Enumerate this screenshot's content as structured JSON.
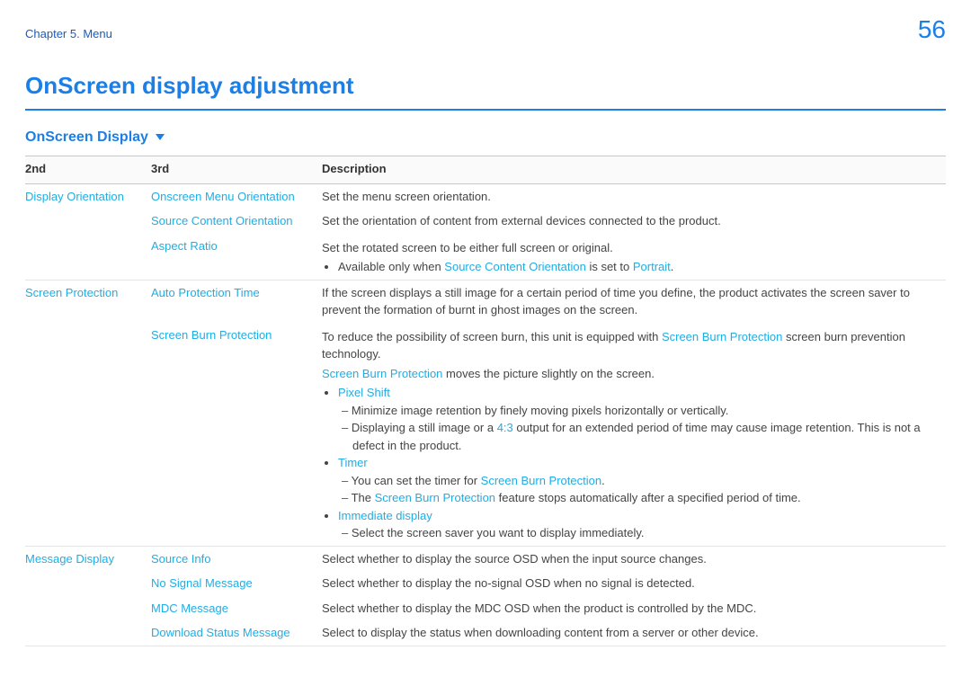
{
  "header": {
    "chapter": "Chapter 5. Menu",
    "page_number": "56"
  },
  "titles": {
    "main": "OnScreen display adjustment",
    "section": "OnScreen Display"
  },
  "columns": {
    "c1": "2nd",
    "c2": "3rd",
    "c3": "Description"
  },
  "g1": {
    "l2": "Display Orientation",
    "r1": {
      "l3": "Onscreen Menu Orientation",
      "desc": "Set the menu screen orientation."
    },
    "r2": {
      "l3": "Source Content Orientation",
      "desc": "Set the orientation of content from external devices connected to the product."
    },
    "r3": {
      "l3": "Aspect Ratio",
      "desc": "Set the rotated screen to be either full screen or original.",
      "note_a": "Available only when ",
      "note_link1": "Source Content Orientation",
      "note_b": " is set to ",
      "note_link2": "Portrait",
      "note_c": "."
    }
  },
  "g2": {
    "l2": "Screen Protection",
    "r1": {
      "l3": "Auto Protection Time",
      "desc": "If the screen displays a still image for a certain period of time you define, the product activates the screen saver to prevent the formation of burnt in ghost images on the screen."
    },
    "r2": {
      "l3": "Screen Burn Protection",
      "p1a": "To reduce the possibility of screen burn, this unit is equipped with ",
      "p1link": "Screen Burn Protection",
      "p1b": " screen burn prevention technology.",
      "p2link": "Screen Burn Protection",
      "p2b": " moves the picture slightly on the screen.",
      "b1": "Pixel Shift",
      "b1s1": "Minimize image retention by finely moving pixels horizontally or vertically.",
      "b1s2a": "Displaying a still image or a ",
      "b1s2link": "4:3",
      "b1s2b": " output for an extended period of time may cause image retention. This is not a defect in the product.",
      "b2": "Timer",
      "b2s1a": "You can set the timer for ",
      "b2s1link": "Screen Burn Protection",
      "b2s1b": ".",
      "b2s2a": "The ",
      "b2s2link": "Screen Burn Protection",
      "b2s2b": " feature stops automatically after a specified period of time.",
      "b3": "Immediate display",
      "b3s1": "Select the screen saver you want to display immediately."
    }
  },
  "g3": {
    "l2": "Message Display",
    "r1": {
      "l3": "Source Info",
      "desc": "Select whether to display the source OSD when the input source changes."
    },
    "r2": {
      "l3": "No Signal Message",
      "desc": "Select whether to display the no-signal OSD when no signal is detected."
    },
    "r3": {
      "l3": "MDC Message",
      "desc": "Select whether to display the MDC OSD when the product is controlled by the MDC."
    },
    "r4": {
      "l3": "Download Status Message",
      "desc": "Select to display the status when downloading content from a server or other device."
    }
  }
}
